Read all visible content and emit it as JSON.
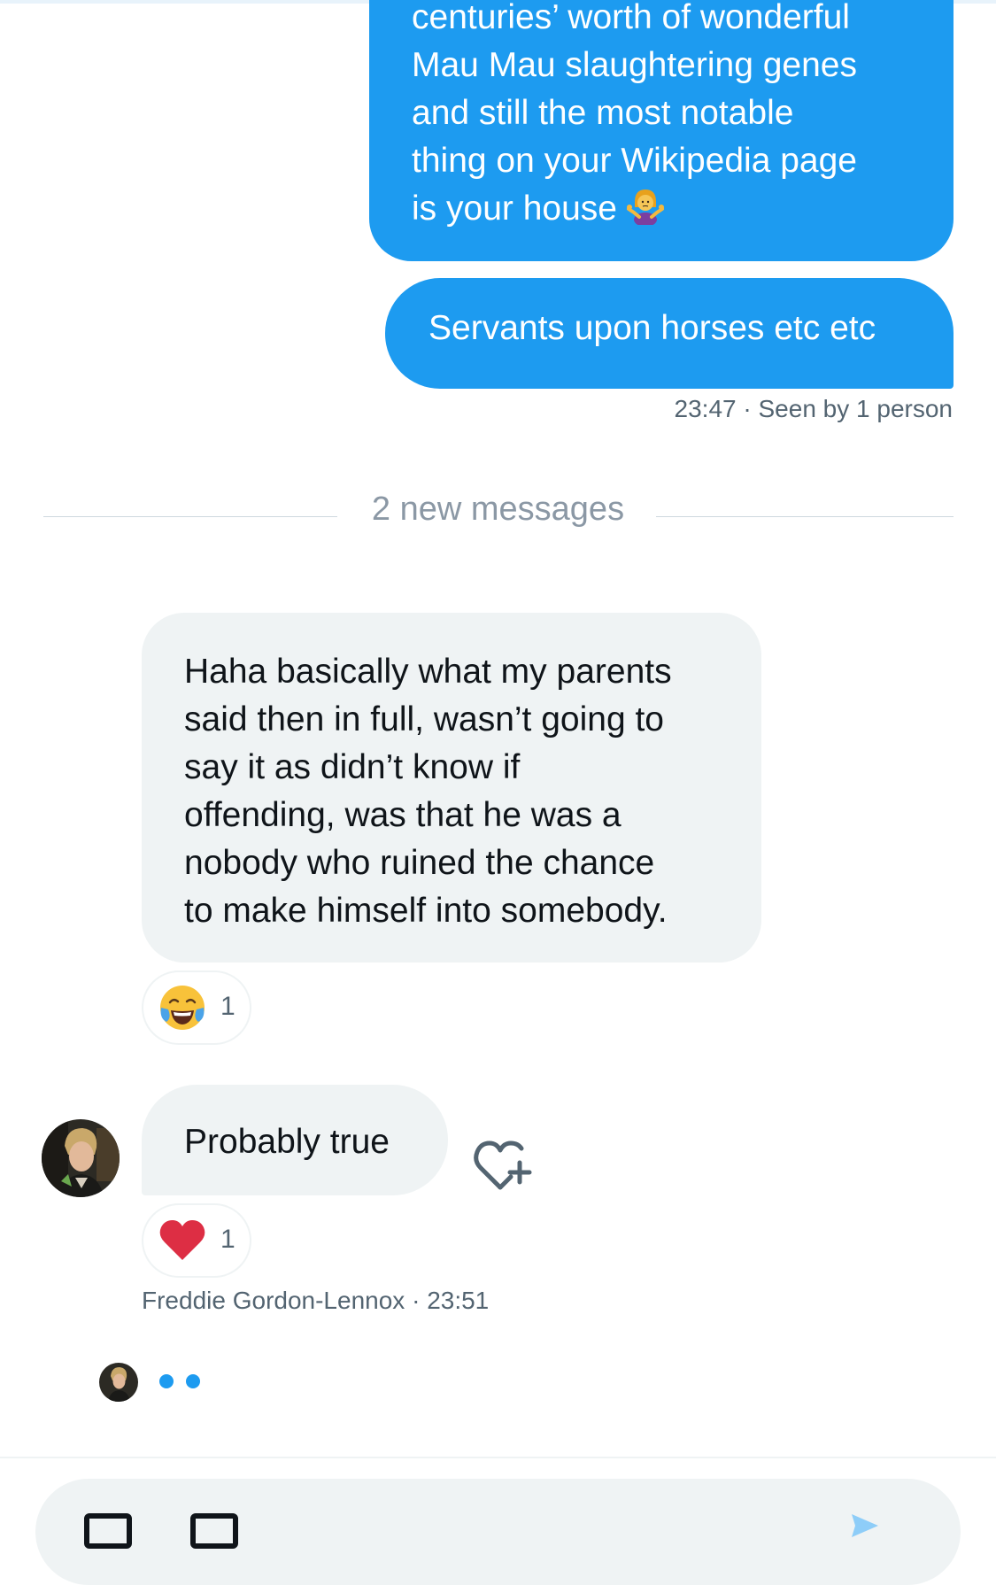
{
  "outgoing": {
    "message1_lines": [
      "centuries’ worth of wonderful",
      "Mau Mau slaughtering genes",
      "and still the most notable",
      "thing on your Wikipedia page",
      "is your house"
    ],
    "message1_emoji": "person-shrugging-emoji",
    "message2": "Servants upon horses etc etc",
    "time": "23:47",
    "separator": " · ",
    "seen_status": "Seen by 1 person"
  },
  "divider": {
    "label": "2 new messages"
  },
  "incoming": {
    "message1_lines": [
      "Haha basically what my parents",
      "said then in full, wasn’t going to",
      "say it as didn’t know if",
      "offending, was that he was a",
      "nobody who ruined the chance",
      "to make himself into somebody."
    ],
    "message1_reaction": {
      "emoji": "face-with-tears-of-joy-emoji",
      "count": "1"
    },
    "message2": "Probably true",
    "message2_reaction": {
      "emoji": "red-heart-emoji",
      "count": "1"
    },
    "sender": "Freddie Gordon-Lennox",
    "separator": " · ",
    "time": "23:51",
    "add_reaction_icon": "heart-plus-icon"
  },
  "typing_indicator": {
    "icon": "typing-dots-icon"
  },
  "composer": {
    "media_icon": "image-icon",
    "gif_icon": "gif-icon",
    "send_icon": "send-icon"
  },
  "colors": {
    "accent": "#1d9bf0",
    "incoming_bubble": "#eff3f4",
    "secondary_text": "#536471",
    "heart": "#e0245e"
  }
}
